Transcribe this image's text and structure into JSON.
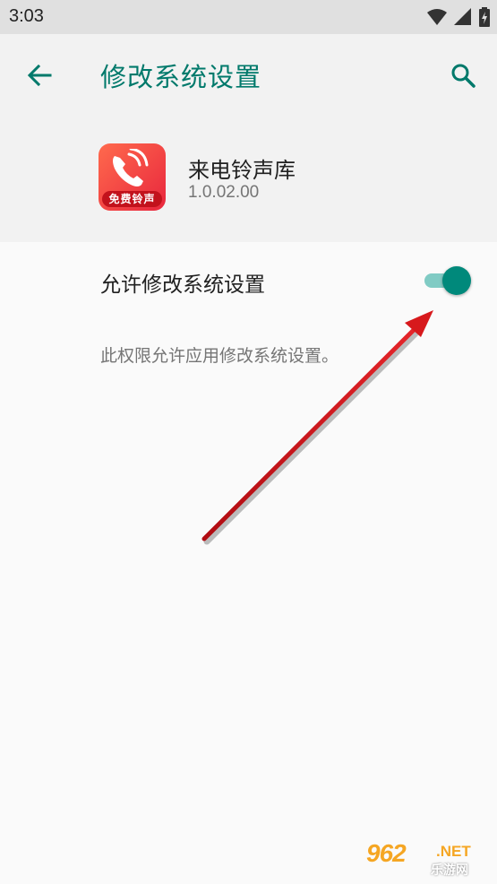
{
  "status_bar": {
    "time": "3:03",
    "icons": [
      "wifi-icon",
      "signal-icon",
      "battery-charging-icon"
    ]
  },
  "app_bar": {
    "title": "修改系统设置",
    "back_icon": "arrow-left-icon",
    "search_icon": "search-icon",
    "accent_color": "#00796b"
  },
  "app_info": {
    "name": "来电铃声库",
    "version": "1.0.02.00",
    "icon_badge": "免费铃声"
  },
  "setting": {
    "label": "允许修改系统设置",
    "enabled": true,
    "summary": "此权限允许应用修改系统设置。",
    "switch_color": "#00897b"
  },
  "annotation": {
    "arrow_color": "#d7191c"
  },
  "watermark": {
    "logo": "962",
    "domain": ".NET",
    "subtitle": "乐游网"
  }
}
